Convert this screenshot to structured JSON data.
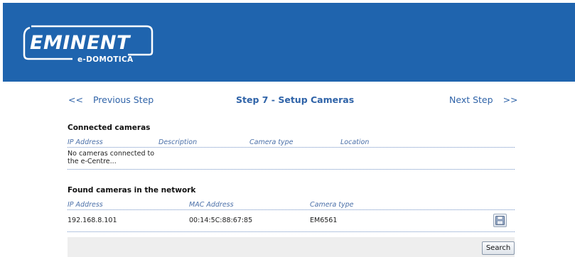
{
  "brand": {
    "name": "EMINENT",
    "subtitle": "e-DOMOTICA",
    "header_color": "#1f64ae"
  },
  "nav": {
    "prev_arrows": "<<",
    "prev_label": "Previous Step",
    "title": "Step 7 - Setup Cameras",
    "next_label": "Next Step",
    "next_arrows": ">>"
  },
  "connected": {
    "title": "Connected cameras",
    "columns": [
      "IP Address",
      "Description",
      "Camera type",
      "Location"
    ],
    "empty_message": "No cameras connected to the e-Centre..."
  },
  "found": {
    "title": "Found cameras in the network",
    "columns": [
      "IP Address",
      "MAC Address",
      "Camera type"
    ],
    "rows": [
      {
        "ip": "192.168.8.101",
        "mac": "00:14:5C:88:67:85",
        "type": "EM6561",
        "action_icon": "save-icon"
      }
    ]
  },
  "search_button": {
    "label": "Search"
  }
}
